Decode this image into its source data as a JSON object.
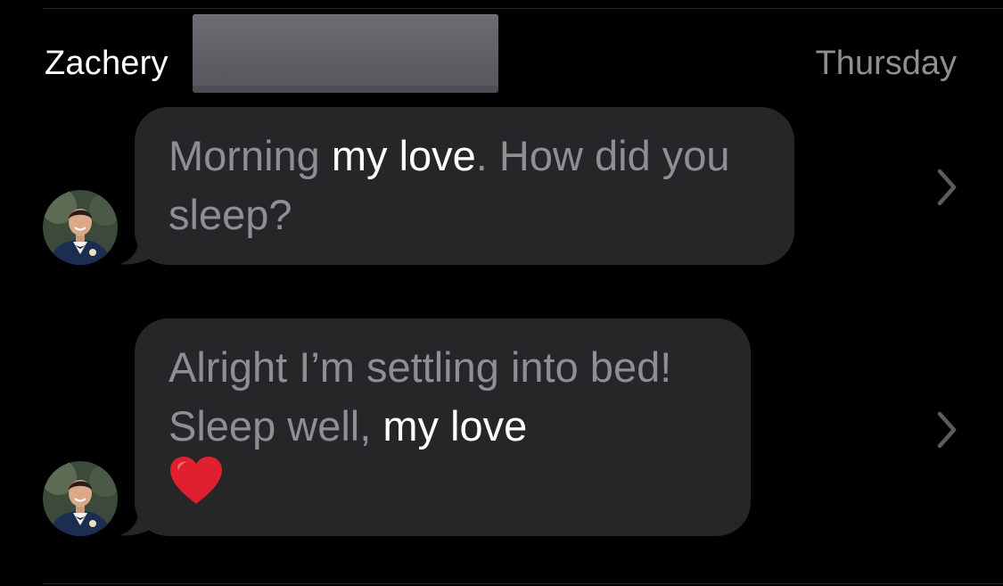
{
  "header": {
    "sender_name": "Zachery",
    "date": "Thursday"
  },
  "messages": [
    {
      "parts": [
        {
          "text": "Morning ",
          "highlight": false
        },
        {
          "text": "my love",
          "highlight": true
        },
        {
          "text": ". How did you sleep?",
          "highlight": false
        }
      ]
    },
    {
      "parts": [
        {
          "text": "Alright I’m settling into bed! Sleep well, ",
          "highlight": false
        },
        {
          "text": "my love",
          "highlight": true
        }
      ],
      "emoji": "heart-emoji"
    }
  ],
  "colors": {
    "background": "#000000",
    "bubble": "#262628",
    "text_dim": "#8e8e93",
    "text_highlight": "#ffffff",
    "heart": "#e0202e"
  },
  "icons": [
    "chevron-right-icon",
    "heart-emoji",
    "avatar-photo"
  ]
}
